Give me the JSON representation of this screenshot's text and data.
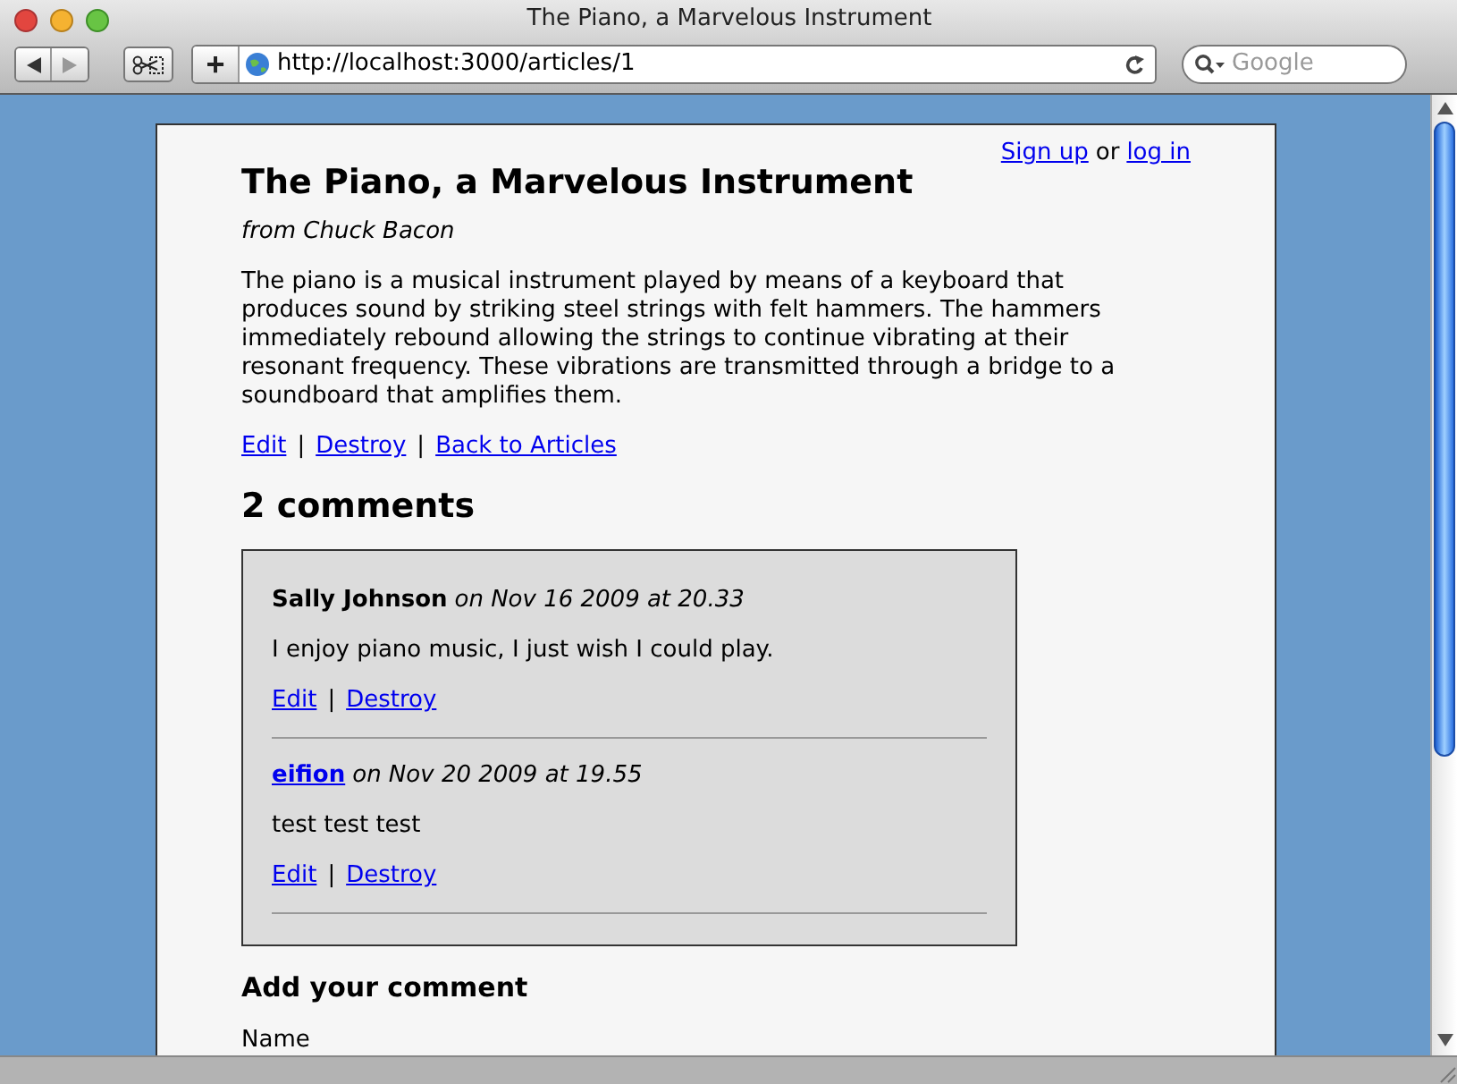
{
  "window": {
    "title": "The Piano, a Marvelous Instrument"
  },
  "toolbar": {
    "url": "http://localhost:3000/articles/1",
    "search": {
      "placeholder": "Google"
    },
    "add_button": "+"
  },
  "page": {
    "auth": {
      "sign_up": "Sign up",
      "separator": "or",
      "log_in": "log in"
    },
    "title": "The Piano, a Marvelous Instrument",
    "byline": "from Chuck Bacon",
    "body": "The piano is a musical instrument played by means of a keyboard that produces sound by striking steel strings with felt hammers. The hammers immediately rebound allowing the strings to continue vibrating at their resonant frequency. These vibrations are transmitted through a bridge to a soundboard that amplifies them.",
    "actions": [
      "Edit",
      "Destroy",
      "Back to Articles"
    ],
    "action_separators": [
      "|",
      "|"
    ],
    "comments_heading": "2 comments",
    "comments": [
      {
        "author": "Sally Johnson",
        "linked": false,
        "date": "on Nov 16 2009 at 20.33",
        "text": "I enjoy piano music, I just wish I could play.",
        "actions": [
          "Edit",
          "Destroy"
        ],
        "action_separators": [
          "|"
        ]
      },
      {
        "author": "eifion",
        "linked": true,
        "date": "on Nov 20 2009 at 19.55",
        "text": "test test test",
        "actions": [
          "Edit",
          "Destroy"
        ],
        "action_separators": [
          "|"
        ]
      }
    ],
    "form_heading": "Add your comment",
    "form_label": "Name"
  }
}
